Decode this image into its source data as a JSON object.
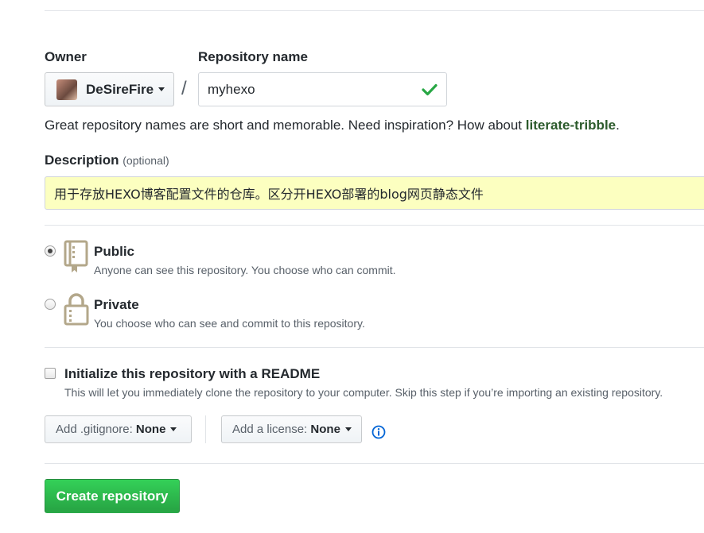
{
  "owner": {
    "label": "Owner",
    "selected": "DeSireFire"
  },
  "separator": "/",
  "repo_name": {
    "label": "Repository name",
    "value": "myhexo"
  },
  "hint": {
    "text": "Great repository names are short and memorable. Need inspiration? How about ",
    "suggestion": "literate-tribble",
    "suffix": "."
  },
  "description": {
    "label": "Description",
    "optional": "(optional)",
    "value": "用于存放HEXO博客配置文件的仓库。区分开HEXO部署的blog网页静态文件"
  },
  "visibility": {
    "public": {
      "title": "Public",
      "desc": "Anyone can see this repository. You choose who can commit.",
      "checked": true
    },
    "private": {
      "title": "Private",
      "desc": "You choose who can see and commit to this repository.",
      "checked": false
    }
  },
  "readme": {
    "title": "Initialize this repository with a README",
    "desc": "This will let you immediately clone the repository to your computer. Skip this step if you’re importing an existing repository."
  },
  "gitignore": {
    "prefix": "Add .gitignore: ",
    "value": "None"
  },
  "license": {
    "prefix": "Add a license: ",
    "value": "None"
  },
  "submit": {
    "label": "Create repository"
  },
  "icons": {
    "check": "check-icon",
    "info": "info-icon",
    "repo": "repo-book-icon",
    "lock": "lock-icon"
  },
  "colors": {
    "success": "#28a745",
    "link_green": "#2c5b2c",
    "input_autofill": "#fcffc0",
    "info_blue": "#0366d6",
    "icon_tan": "#b3a78a"
  }
}
